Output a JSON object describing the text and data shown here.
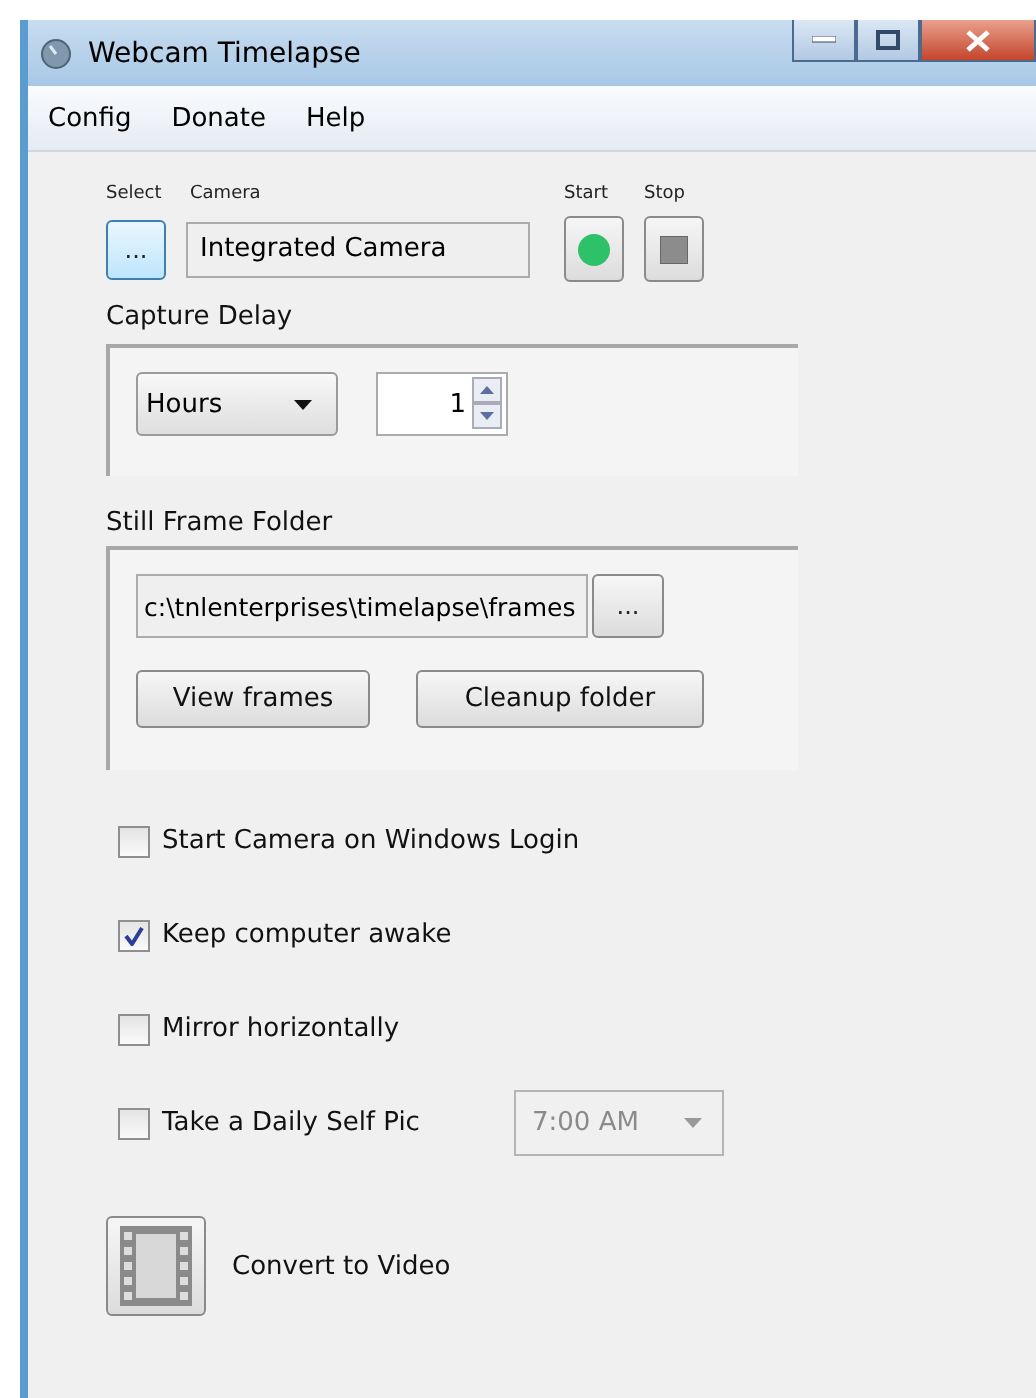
{
  "window": {
    "title": "Webcam Timelapse"
  },
  "menu": [
    "Config",
    "Donate",
    "Help"
  ],
  "camera": {
    "select_label": "Select",
    "camera_label": "Camera",
    "browse": "...",
    "value": "Integrated Camera",
    "start_label": "Start",
    "stop_label": "Stop"
  },
  "capture_delay": {
    "title": "Capture Delay",
    "unit": "Hours",
    "value": "1"
  },
  "still_frame_folder": {
    "title": "Still Frame Folder",
    "path": "c:\\tnlenterprises\\timelapse\\frames",
    "browse": "...",
    "buttons": [
      "View frames",
      "Cleanup folder"
    ]
  },
  "options": [
    {
      "label": "Start Camera on Windows Login",
      "checked": false
    },
    {
      "label": "Keep computer awake",
      "checked": true
    },
    {
      "label": "Mirror horizontally",
      "checked": false
    },
    {
      "label": "Take a Daily Self Pic",
      "checked": false,
      "time": "7:00 AM",
      "time_disabled": true
    }
  ],
  "convert": {
    "label": "Convert to Video"
  }
}
